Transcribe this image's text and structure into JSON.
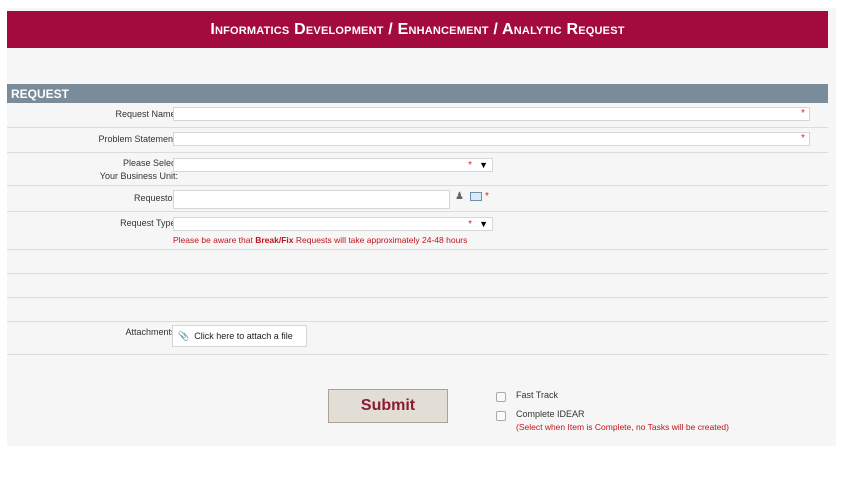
{
  "header": {
    "title": "Informatics Development / Enhancement / Analytic Request"
  },
  "section": {
    "title": "REQUEST"
  },
  "fields": {
    "request_name": {
      "label": "Request Name:",
      "value": "",
      "required_mark": "*"
    },
    "problem_statement": {
      "label": "Problem Statement:",
      "value": "",
      "required_mark": "*"
    },
    "business_unit": {
      "label_line1": "Please Select",
      "label_line2": "Your Business Unit:",
      "selected": "",
      "required_mark": "*",
      "arrow": "▼"
    },
    "requestor": {
      "label": "Requestor:",
      "value": "",
      "required_mark": "*"
    },
    "request_type": {
      "label": "Request Type:",
      "selected": "",
      "required_mark": "*",
      "arrow": "▼",
      "warning_pre": "Please be aware that ",
      "warning_bold": "Break/Fix",
      "warning_post": " Requests will take approximately 24-48 hours"
    },
    "attachments": {
      "label": "Attachments:",
      "button_label": "Click here to attach a file"
    }
  },
  "actions": {
    "submit_label": "Submit"
  },
  "options": {
    "fast_track": {
      "label": "Fast Track",
      "checked": false
    },
    "complete_idear": {
      "label": "Complete IDEAR",
      "checked": false,
      "note": "(Select when Item is Complete, no Tasks will be created)"
    }
  },
  "colors": {
    "banner": "#a30b3e",
    "section_bar": "#7a8b99",
    "required": "#dd2222",
    "warning": "#c0141c",
    "submit_text": "#8b1b34"
  }
}
